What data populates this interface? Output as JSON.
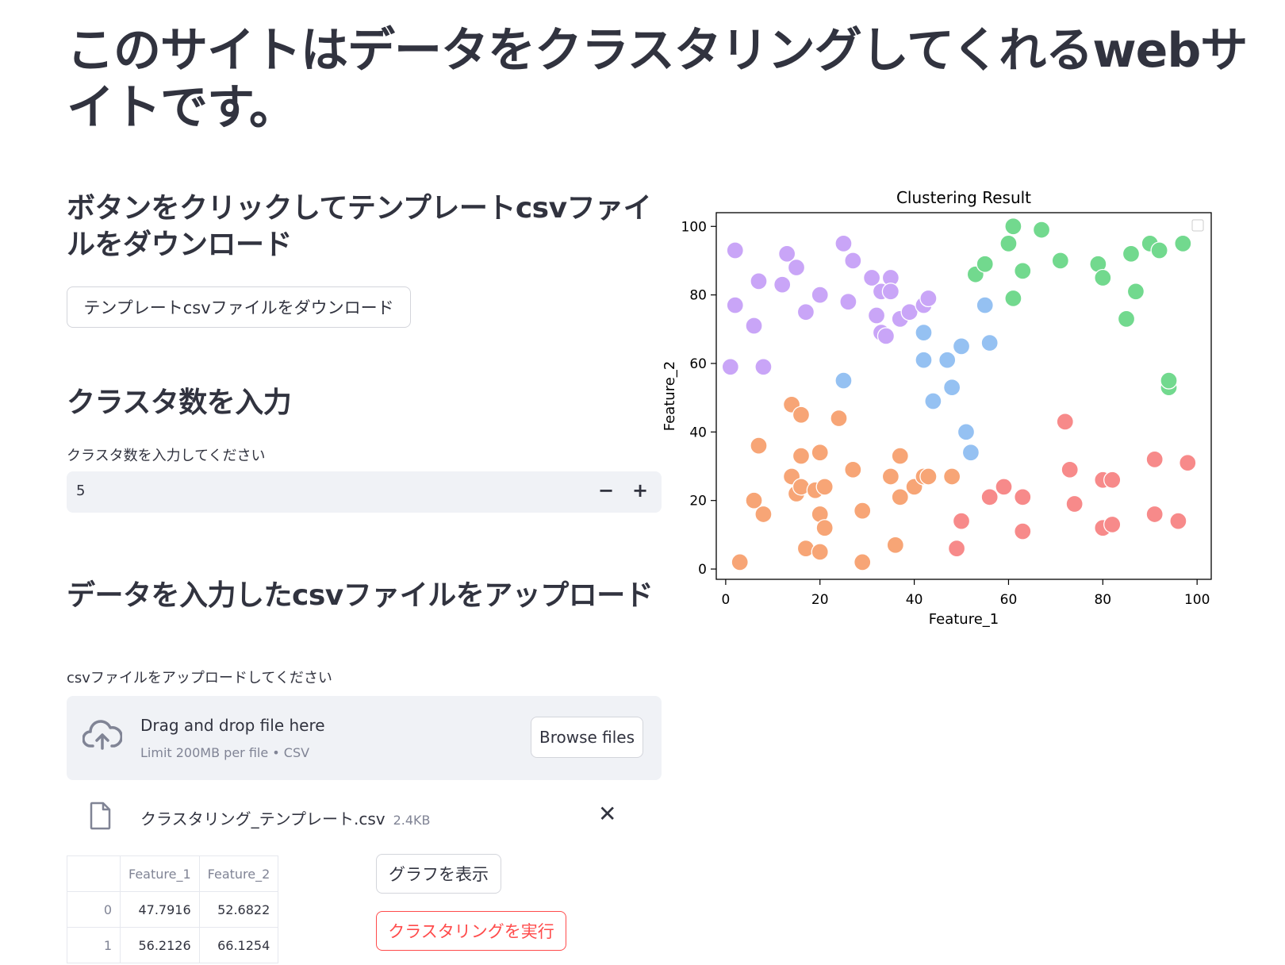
{
  "page": {
    "title": "このサイトはデータをクラスタリングしてくれるwebサイトです。"
  },
  "download": {
    "header": "ボタンをクリックしてテンプレートcsvファイルをダウンロード",
    "button_label": "テンプレートcsvファイルをダウンロード"
  },
  "cluster_input": {
    "header": "クラスタ数を入力",
    "label": "クラスタ数を入力してください",
    "value": "5",
    "minus": "−",
    "plus": "+"
  },
  "upload": {
    "header": "データを入力したcsvファイルをアップロード",
    "label": "csvファイルをアップロードしてください",
    "drop_text": "Drag and drop file here",
    "limit_text": "Limit 200MB per file • CSV",
    "browse_label": "Browse files",
    "file_name": "クラスタリング_テンプレート.csv",
    "file_size": "2.4KB",
    "close": "✕"
  },
  "table": {
    "columns": [
      "",
      "Feature_1",
      "Feature_2"
    ],
    "rows": [
      [
        "0",
        "47.7916",
        "52.6822"
      ],
      [
        "1",
        "56.2126",
        "66.1254"
      ]
    ]
  },
  "buttons": {
    "show_graph": "グラフを表示",
    "run_clustering": "クラスタリングを実行"
  },
  "icons": {
    "upload": "cloud-upload-icon",
    "file": "file-icon",
    "close": "close-icon"
  },
  "colors": {
    "primary_red": "#ff4b4b",
    "widget_bg": "#f0f2f6",
    "text": "#31333f"
  },
  "chart_data": {
    "type": "scatter",
    "title": "Clustering Result",
    "xlabel": "Feature_1",
    "ylabel": "Feature_2",
    "xlim": [
      -2,
      103
    ],
    "ylim": [
      -3,
      104
    ],
    "xticks": [
      0,
      20,
      40,
      60,
      80,
      100
    ],
    "yticks": [
      0,
      20,
      40,
      60,
      80,
      100
    ],
    "legend": "top-right",
    "series": [
      {
        "color": "#c9a5f7",
        "points": [
          [
            2,
            93
          ],
          [
            2,
            77
          ],
          [
            6,
            71
          ],
          [
            7,
            84
          ],
          [
            8,
            59
          ],
          [
            1,
            59
          ],
          [
            12,
            83
          ],
          [
            13,
            92
          ],
          [
            15,
            88
          ],
          [
            17,
            75
          ],
          [
            20,
            80
          ],
          [
            25,
            95
          ],
          [
            26,
            78
          ],
          [
            27,
            90
          ],
          [
            31,
            85
          ],
          [
            32,
            74
          ],
          [
            33,
            81
          ],
          [
            33,
            69
          ],
          [
            34,
            68
          ],
          [
            35,
            85
          ],
          [
            35,
            81
          ],
          [
            37,
            73
          ],
          [
            39,
            75
          ],
          [
            42,
            77
          ],
          [
            43,
            79
          ]
        ]
      },
      {
        "color": "#95c1f2",
        "points": [
          [
            25,
            55
          ],
          [
            42,
            69
          ],
          [
            42,
            61
          ],
          [
            44,
            49
          ],
          [
            47,
            61
          ],
          [
            48,
            53
          ],
          [
            50,
            65
          ],
          [
            51,
            40
          ],
          [
            52,
            34
          ],
          [
            55,
            77
          ],
          [
            56,
            66
          ]
        ]
      },
      {
        "color": "#72d98e",
        "points": [
          [
            53,
            86
          ],
          [
            55,
            89
          ],
          [
            60,
            95
          ],
          [
            61,
            100
          ],
          [
            61,
            79
          ],
          [
            63,
            87
          ],
          [
            67,
            99
          ],
          [
            71,
            90
          ],
          [
            79,
            89
          ],
          [
            80,
            85
          ],
          [
            85,
            73
          ],
          [
            86,
            92
          ],
          [
            87,
            81
          ],
          [
            90,
            95
          ],
          [
            92,
            93
          ],
          [
            94,
            53
          ],
          [
            94,
            55
          ],
          [
            97,
            95
          ]
        ]
      },
      {
        "color": "#f7a576",
        "points": [
          [
            3,
            2
          ],
          [
            6,
            20
          ],
          [
            7,
            36
          ],
          [
            8,
            16
          ],
          [
            14,
            27
          ],
          [
            14,
            48
          ],
          [
            15,
            22
          ],
          [
            16,
            45
          ],
          [
            16,
            33
          ],
          [
            16,
            24
          ],
          [
            17,
            6
          ],
          [
            19,
            23
          ],
          [
            20,
            34
          ],
          [
            20,
            5
          ],
          [
            20,
            16
          ],
          [
            21,
            12
          ],
          [
            21,
            24
          ],
          [
            24,
            44
          ],
          [
            27,
            29
          ],
          [
            29,
            17
          ],
          [
            29,
            2
          ],
          [
            35,
            27
          ],
          [
            36,
            7
          ],
          [
            37,
            21
          ],
          [
            37,
            33
          ],
          [
            40,
            24
          ],
          [
            42,
            27
          ],
          [
            43,
            27
          ],
          [
            48,
            27
          ]
        ]
      },
      {
        "color": "#f78a8a",
        "points": [
          [
            49,
            6
          ],
          [
            50,
            14
          ],
          [
            56,
            21
          ],
          [
            59,
            24
          ],
          [
            63,
            11
          ],
          [
            63,
            21
          ],
          [
            72,
            43
          ],
          [
            73,
            29
          ],
          [
            74,
            19
          ],
          [
            80,
            12
          ],
          [
            80,
            26
          ],
          [
            82,
            26
          ],
          [
            82,
            13
          ],
          [
            91,
            16
          ],
          [
            91,
            32
          ],
          [
            96,
            14
          ],
          [
            98,
            31
          ]
        ]
      }
    ]
  }
}
